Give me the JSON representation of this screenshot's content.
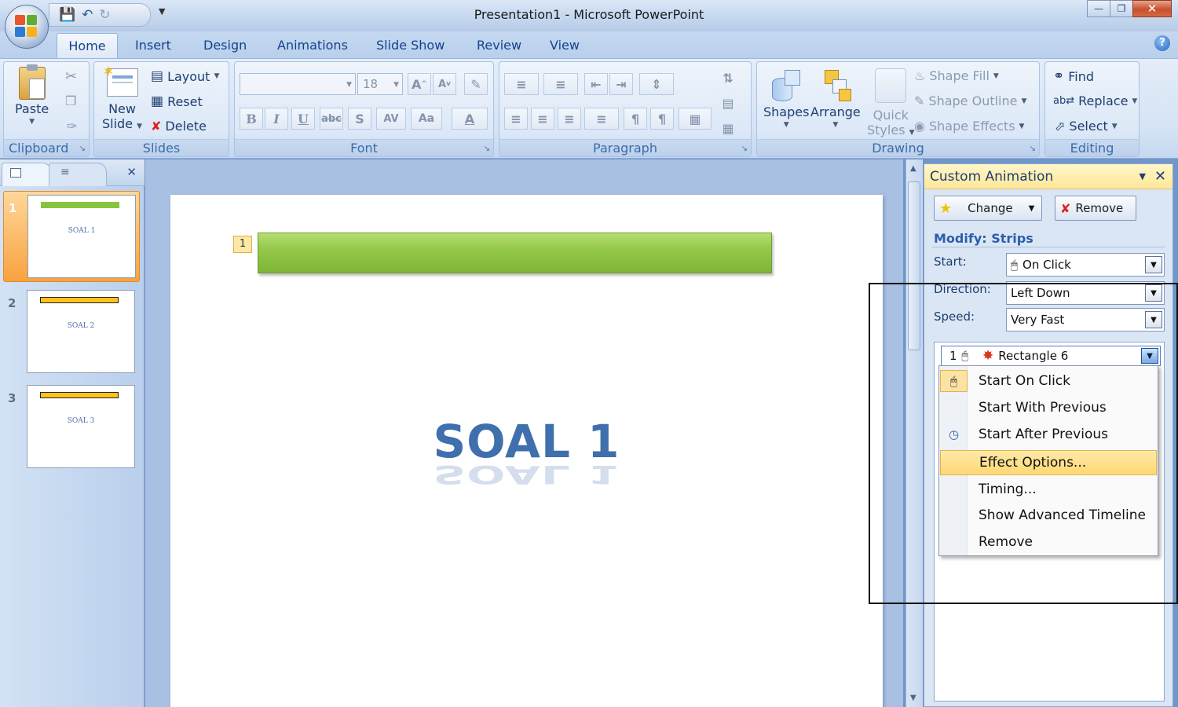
{
  "window": {
    "title": "Presentation1  -  Microsoft PowerPoint",
    "controls": [
      "minimize",
      "restore",
      "close"
    ]
  },
  "quick_access": {
    "icons": [
      "save-icon",
      "undo-icon",
      "redo-icon",
      "customize-icon"
    ]
  },
  "tabs": [
    "Home",
    "Insert",
    "Design",
    "Animations",
    "Slide Show",
    "Review",
    "View"
  ],
  "active_tab": "Home",
  "ribbon": {
    "clipboard": {
      "label": "Clipboard",
      "paste": "Paste"
    },
    "slides": {
      "label": "Slides",
      "new_slide_1": "New",
      "new_slide_2": "Slide",
      "layout": "Layout",
      "reset": "Reset",
      "delete": "Delete"
    },
    "font": {
      "label": "Font",
      "font_name": "",
      "font_size": "18"
    },
    "paragraph": {
      "label": "Paragraph"
    },
    "drawing": {
      "label": "Drawing",
      "shapes": "Shapes",
      "arrange": "Arrange",
      "quick_styles_1": "Quick",
      "quick_styles_2": "Styles",
      "shape_fill": "Shape Fill",
      "shape_outline": "Shape Outline",
      "shape_effects": "Shape Effects"
    },
    "editing": {
      "label": "Editing",
      "find": "Find",
      "replace": "Replace",
      "select": "Select"
    }
  },
  "slides_panel": {
    "thumbnails": [
      {
        "number": "1",
        "text": "SOAL 1",
        "bar_color": "#86c43e",
        "active": true
      },
      {
        "number": "2",
        "text": "SOAL 2",
        "bar_color": "#ffc21b",
        "active": false
      },
      {
        "number": "3",
        "text": "SOAL 3",
        "bar_color": "#ffc21b",
        "active": false
      }
    ]
  },
  "slide": {
    "animation_tag": "1",
    "title": "SOAL  1"
  },
  "custom_animation": {
    "title": "Custom Animation",
    "change_button": "Change",
    "remove_button": "Remove",
    "modify_label": "Modify: Strips",
    "start_label": "Start:",
    "start_value": "On Click",
    "direction_label": "Direction:",
    "direction_value": "Left Down",
    "speed_label": "Speed:",
    "speed_value": "Very Fast",
    "list_item": {
      "order": "1",
      "name": "Rectangle 6"
    }
  },
  "context_menu": {
    "items": [
      {
        "label": "Start On Click",
        "icon": "mouse-icon"
      },
      {
        "label": "Start With Previous",
        "icon": ""
      },
      {
        "label": "Start After Previous",
        "icon": "clock-icon"
      },
      {
        "label": "Effect Options...",
        "icon": "",
        "highlighted": true
      },
      {
        "label": "Timing...",
        "icon": ""
      },
      {
        "label": "Show Advanced Timeline",
        "icon": ""
      },
      {
        "label": "Remove",
        "icon": ""
      }
    ]
  }
}
